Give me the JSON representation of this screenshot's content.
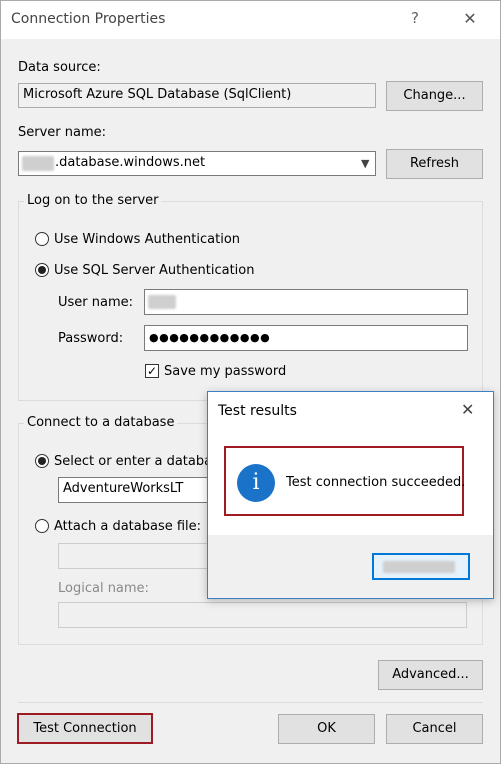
{
  "window": {
    "title": "Connection Properties",
    "help_glyph": "?",
    "close_glyph": "✕"
  },
  "data_source": {
    "label": "Data source:",
    "value": "Microsoft Azure SQL Database (SqlClient)",
    "change_button": "Change..."
  },
  "server_name": {
    "label": "Server name:",
    "value": ".database.windows.net",
    "refresh_button": "Refresh"
  },
  "logon": {
    "group_title": "Log on to the server",
    "windows_auth_label": "Use Windows Authentication",
    "sql_auth_label": "Use SQL Server Authentication",
    "selected": "sql",
    "user_name_label": "User name:",
    "password_label": "Password:",
    "password_value": "●●●●●●●●●●●●",
    "save_password_label": "Save my password",
    "save_password_checked": true
  },
  "database": {
    "group_title": "Connect to a database",
    "select_label": "Select or enter a database",
    "selected_database": "AdventureWorksLT",
    "attach_label": "Attach a database file:",
    "logical_name_label": "Logical name:"
  },
  "footer": {
    "advanced_button": "Advanced...",
    "test_button": "Test Connection",
    "ok_button": "OK",
    "cancel_button": "Cancel"
  },
  "popup": {
    "title": "Test results",
    "close_glyph": "✕",
    "icon_glyph": "i",
    "message": "Test connection succeeded.",
    "accent_color": "#9e1b23",
    "info_color": "#1a73c9"
  }
}
